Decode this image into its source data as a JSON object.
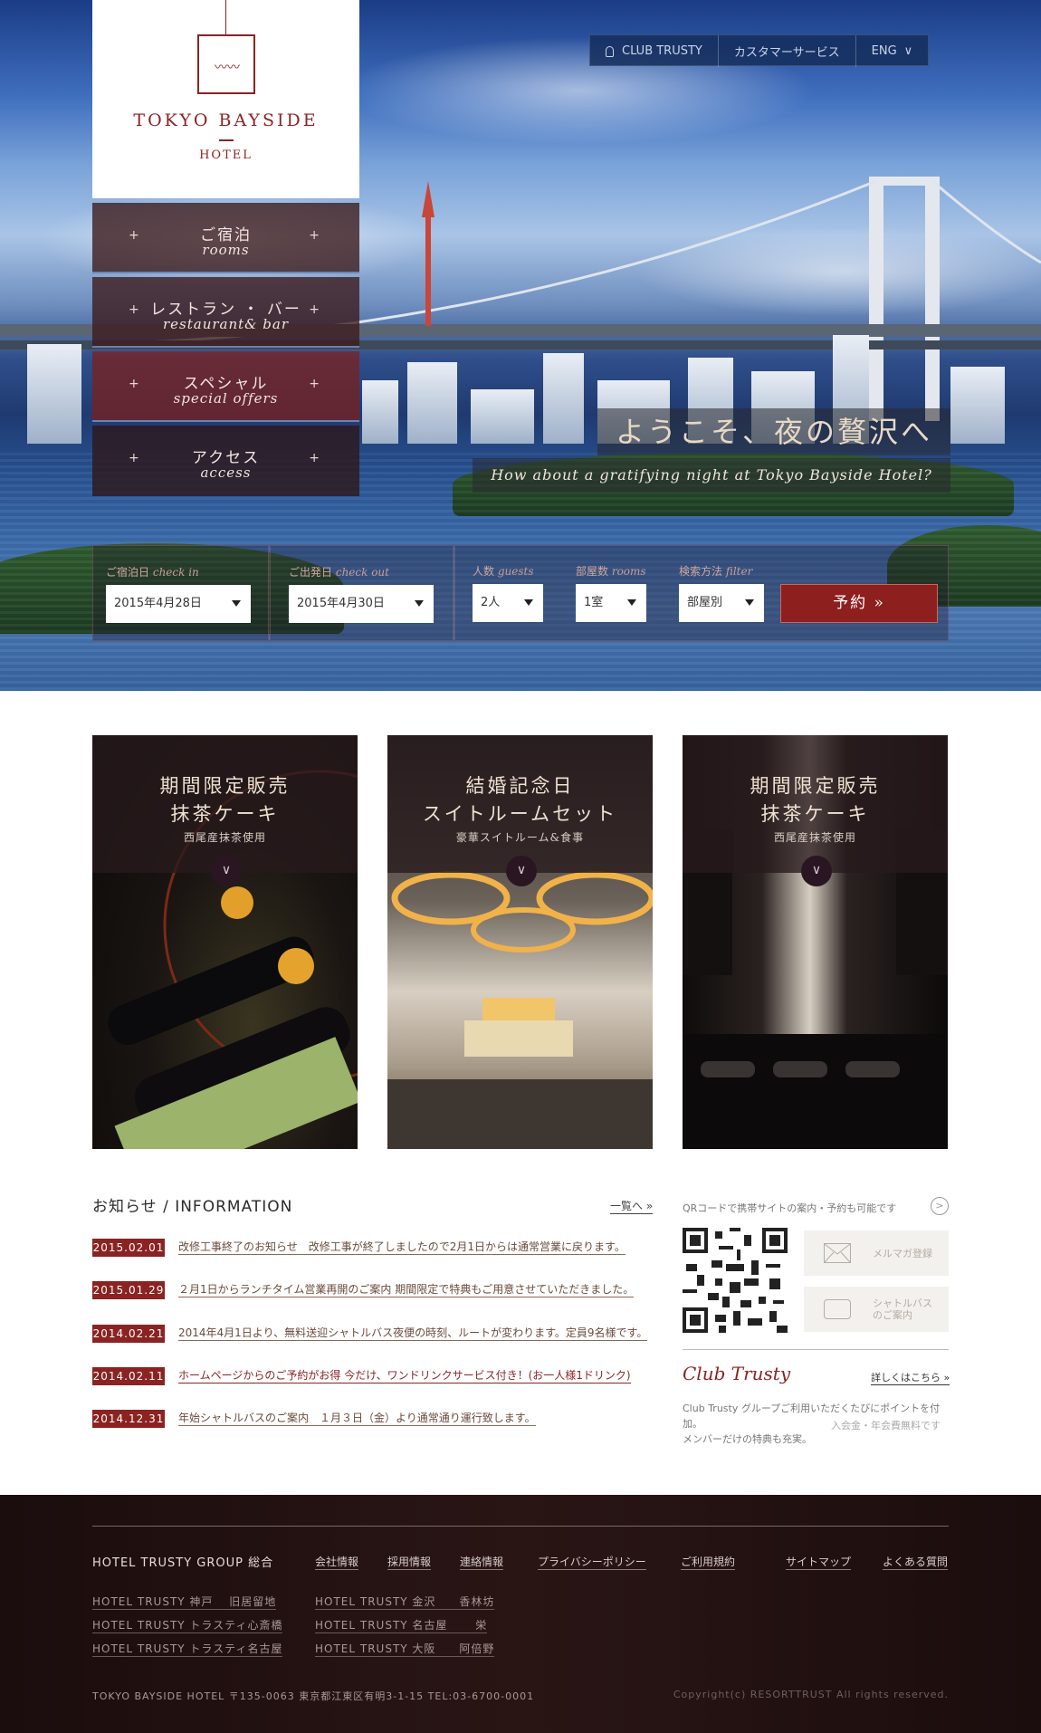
{
  "logo": {
    "name_line1": "TOKYO BAYSIDE",
    "name_line2": "HOTEL"
  },
  "topnav": {
    "club": "CLUB TRUSTY",
    "customer": "カスタマーサービス",
    "lang": "ENG"
  },
  "menu": [
    {
      "jp": "ご宿泊",
      "en": "rooms"
    },
    {
      "jp": "レストラン ・ バー",
      "en": "restaurant& bar"
    },
    {
      "jp": "スペシャル",
      "en": "special offers"
    },
    {
      "jp": "アクセス",
      "en": "access"
    }
  ],
  "hero": {
    "headline": "ようこそ、夜の贅沢へ",
    "subline": "How about a gratifying night at Tokyo Bayside Hotel?"
  },
  "booking": {
    "checkin_label": "ご宿泊日",
    "checkin_label_en": "check in",
    "checkin_value": "2015年4月28日",
    "checkout_label": "ご出発日",
    "checkout_label_en": "check out",
    "checkout_value": "2015年4月30日",
    "guests_label": "人数",
    "guests_label_en": "guests",
    "guests_value": "2人",
    "rooms_label": "部屋数",
    "rooms_label_en": "rooms",
    "rooms_value": "1室",
    "filter_label": "検索方法",
    "filter_label_en": "filter",
    "filter_value": "部屋別",
    "submit": "予約 »"
  },
  "features": [
    {
      "line1": "期間限定販売",
      "line2": "抹茶ケーキ",
      "sub": "西尾産抹茶使用"
    },
    {
      "line1": "結婚記念日",
      "line2": "スイトルームセット",
      "sub": "豪華スイトルーム&食事"
    },
    {
      "line1": "期間限定販売",
      "line2": "抹茶ケーキ",
      "sub": "西尾産抹茶使用"
    }
  ],
  "info": {
    "title": "お知らせ / INFORMATION",
    "all_link": "一覧へ »",
    "items": [
      {
        "date": "2015.02.01",
        "text": "改修工事終了のお知らせ　改修工事が終了しましたので2月1日からは通常営業に戻ります。"
      },
      {
        "date": "2015.01.29",
        "text": "２月1日からランチタイム営業再開のご案内 期間限定で特典もご用意させていただきました。"
      },
      {
        "date": "2014.02.21",
        "text": "2014年4月1日より、無料送迎シャトルバス夜便の時刻、ルートが変わります。定員9名様です。"
      },
      {
        "date": "2014.02.11",
        "text": "ホームページからのご予約がお得 今だけ、ワンドリンクサービス付き！(お一人様1ドリンク)"
      },
      {
        "date": "2014.12.31",
        "text": "年始シャトルバスのご案内　１月３日（金）より通常通り運行致します。"
      }
    ]
  },
  "side": {
    "qr_text": "QRコードで携帯サイトの案内・予約も可能です",
    "mail_btn": "メルマガ登録",
    "bus_btn_line1": "シャトルバス",
    "bus_btn_line2": "のご案内",
    "club_name": "Club Trusty",
    "club_more": "詳しくはこちら »",
    "club_desc1": "Club Trusty グループご利用いただくたびにポイントを付加。",
    "club_desc2": "メンバーだけの特典も充実。",
    "club_note": "入会金・年会費無料です"
  },
  "footer": {
    "group": "HOTEL TRUSTY GROUP  総合",
    "links": [
      "会社情報",
      "採用情報",
      "連絡情報",
      "プライバシーポリシー",
      "ご利用規約",
      "サイトマップ",
      "よくある質問"
    ],
    "hotels": [
      "HOTEL TRUSTY 神戸　 旧居留地",
      "HOTEL TRUSTY トラスティ心斎橋",
      "HOTEL TRUSTY トラスティ名古屋",
      "HOTEL TRUSTY 金沢　　香林坊",
      "HOTEL TRUSTY 名古屋　　 栄",
      "HOTEL TRUSTY 大阪　　阿倍野"
    ],
    "address": "TOKYO BAYSIDE HOTEL  〒135-0063  東京都江東区有明3-1-15  TEL:03-6700-0001",
    "copyright": "Copyright(c) RESORTTRUST All rights reserved."
  }
}
